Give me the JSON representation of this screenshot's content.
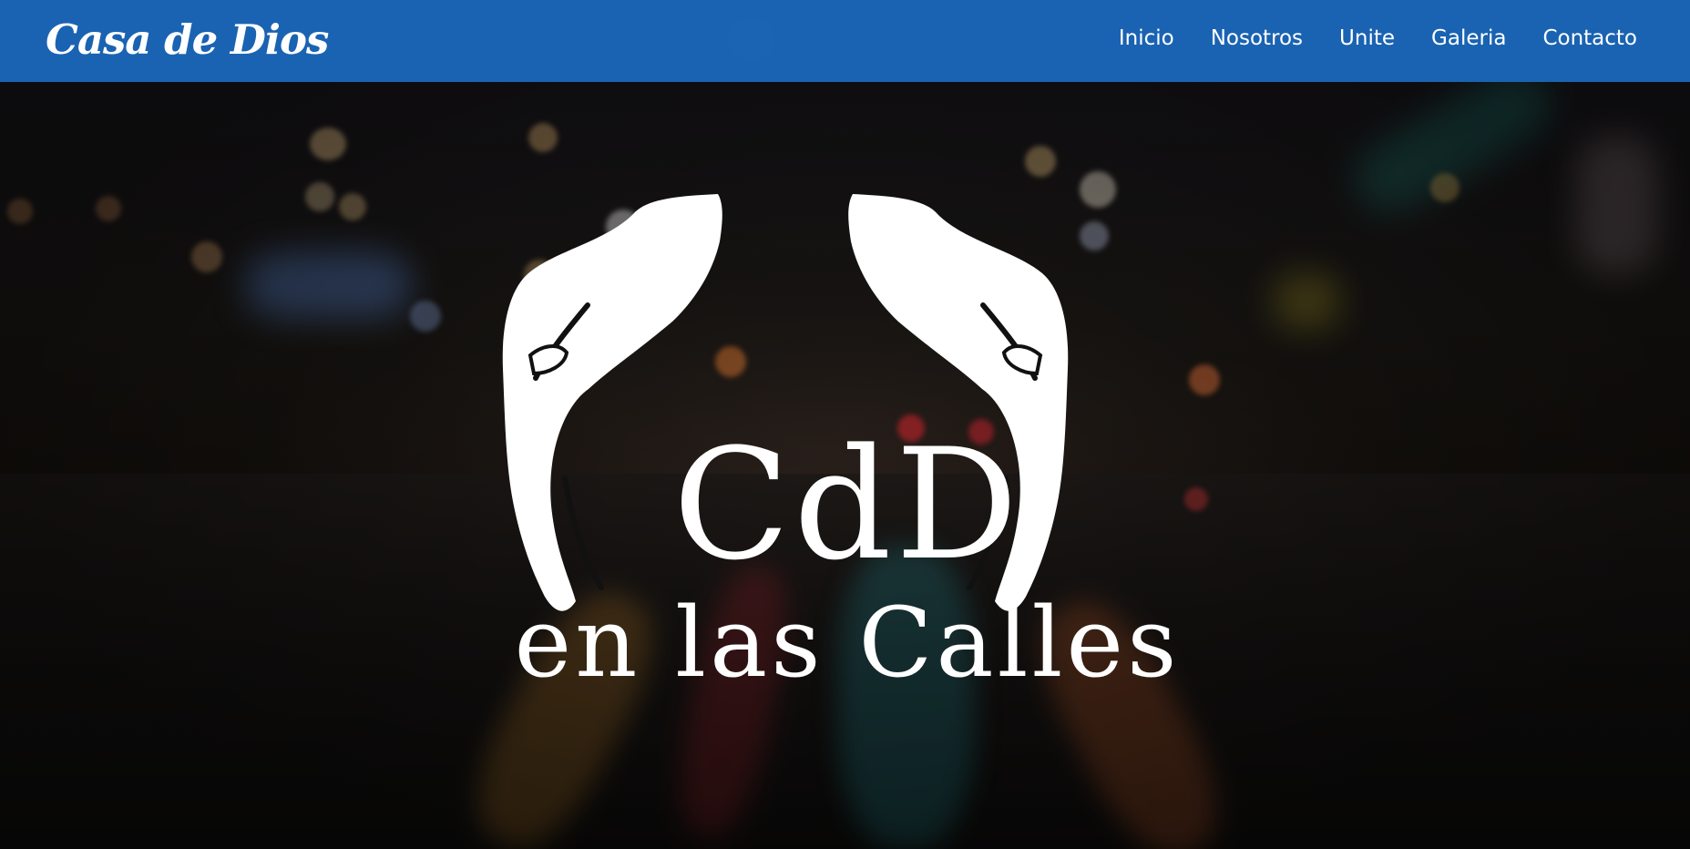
{
  "navbar": {
    "brand": "Casa de Dios",
    "links": [
      "Inicio",
      "Nosotros",
      "Unite",
      "Galeria",
      "Contacto"
    ],
    "background": "#1B66B8"
  },
  "hero": {
    "logo": {
      "mark": "CdD",
      "subtitle": "en las Calles",
      "icon": "cupped-hands-icon",
      "color": "#FFFFFF"
    }
  }
}
